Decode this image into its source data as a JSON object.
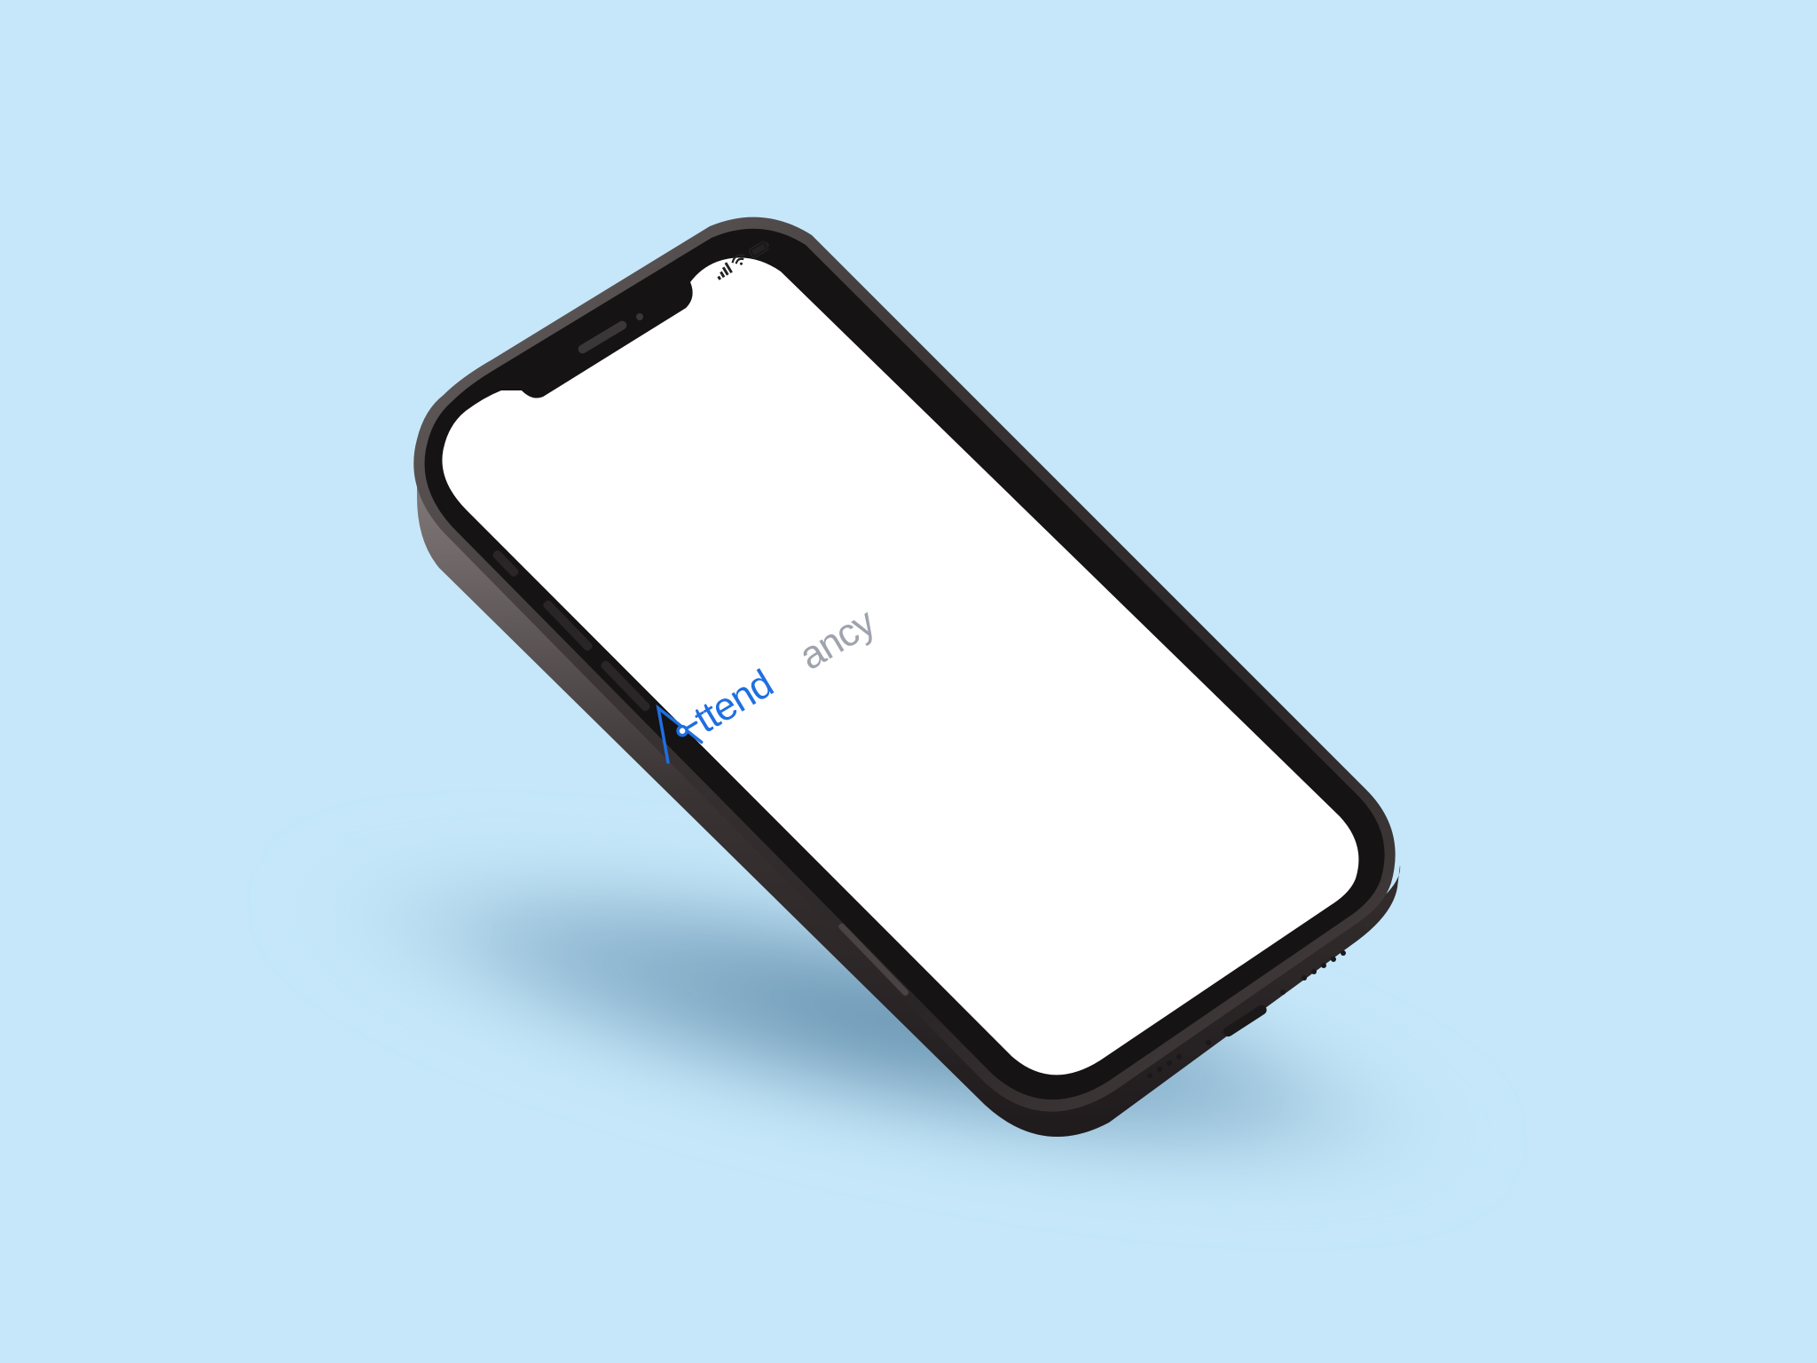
{
  "scene": {
    "background_color": "#c5e7f9",
    "shadow_color": "#5d89a8"
  },
  "phone": {
    "frame_color": "#2f2a2b",
    "bezel_color": "#151314",
    "screen_color": "#ffffff",
    "status_bar": {
      "icons": [
        "signal-icon",
        "wifi-icon",
        "battery-icon"
      ]
    }
  },
  "app": {
    "logo": {
      "part1": "Attend",
      "part2": "ancy",
      "part1_color": "#1f6fe0",
      "part2_color": "#9fa3ad"
    }
  }
}
